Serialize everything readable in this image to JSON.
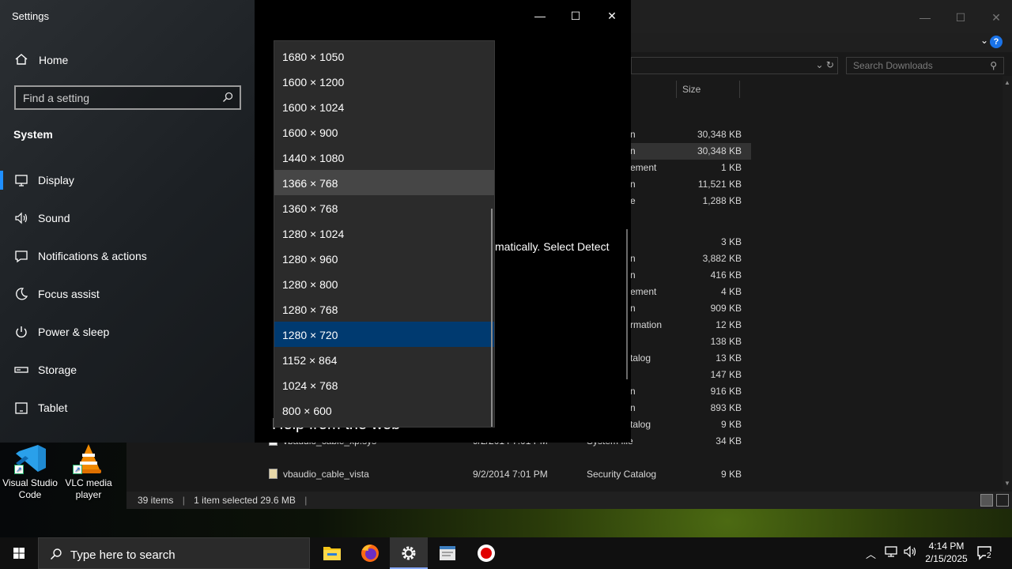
{
  "desktop": {
    "icons": [
      {
        "label_line1": "Visual Studio",
        "label_line2": "Code"
      },
      {
        "label_line1": "VLC media",
        "label_line2": "player"
      }
    ]
  },
  "explorer": {
    "search_placeholder": "Search Downloads",
    "col_size": "Size",
    "upper_rows": [
      {
        "frag": "n",
        "size": "30,348 KB"
      },
      {
        "frag": "n",
        "size": "30,348 KB"
      },
      {
        "frag": "ement",
        "size": "1 KB"
      },
      {
        "frag": "n",
        "size": "11,521 KB"
      },
      {
        "frag": "e",
        "size": "1,288 KB"
      }
    ],
    "lower_rows": [
      {
        "frag": "",
        "size": "3 KB"
      },
      {
        "frag": "n",
        "size": "3,882 KB"
      },
      {
        "frag": "n",
        "size": "416 KB"
      },
      {
        "frag": "ement",
        "size": "4 KB"
      },
      {
        "frag": "n",
        "size": "909 KB"
      },
      {
        "frag": "rmation",
        "size": "12 KB"
      },
      {
        "frag": "",
        "size": "138 KB"
      },
      {
        "frag": "talog",
        "size": "13 KB"
      },
      {
        "frag": "",
        "size": "147 KB"
      },
      {
        "frag": "n",
        "size": "916 KB"
      },
      {
        "frag": "n",
        "size": "893 KB"
      },
      {
        "frag": "talog",
        "size": "9 KB"
      }
    ],
    "file_rows": [
      {
        "name": "vbaudio_cable_xp.sys",
        "date": "9/2/2014 7:01 PM",
        "type": "System file",
        "size": "34 KB"
      },
      {
        "name": "vbaudio_cable_vista",
        "date": "9/2/2014 7:01 PM",
        "type": "Security Catalog",
        "size": "9 KB"
      }
    ],
    "status_items": "39 items",
    "status_selected": "1 item selected  29.6 MB"
  },
  "settings": {
    "title": "Settings",
    "home": "Home",
    "search_placeholder": "Find a setting",
    "section": "System",
    "nav": [
      {
        "label": "Display",
        "icon": "monitor-icon"
      },
      {
        "label": "Sound",
        "icon": "speaker-icon"
      },
      {
        "label": "Notifications & actions",
        "icon": "notification-icon"
      },
      {
        "label": "Focus assist",
        "icon": "moon-icon"
      },
      {
        "label": "Power & sleep",
        "icon": "power-icon"
      },
      {
        "label": "Storage",
        "icon": "storage-icon"
      },
      {
        "label": "Tablet",
        "icon": "tablet-icon"
      }
    ],
    "detect_text": "matically. Select Detect",
    "help_heading": "Help from the web",
    "resolutions": [
      "1680 × 1050",
      "1600 × 1200",
      "1600 × 1024",
      "1600 × 900",
      "1440 × 1080",
      "1366 × 768",
      "1360 × 768",
      "1280 × 1024",
      "1280 × 960",
      "1280 × 800",
      "1280 × 768",
      "1280 × 720",
      "1152 × 864",
      "1024 × 768",
      "800 × 600"
    ],
    "hovered_resolution": "1366 × 768",
    "selected_resolution": "1280 × 720"
  },
  "taskbar": {
    "search_text": "Type here to search",
    "time": "4:14 PM",
    "date": "2/15/2025",
    "notification_count": "2"
  },
  "colors": {
    "accent": "#1f8fff",
    "dropdown_selected": "#003a70",
    "dropdown_hover": "#464646"
  }
}
